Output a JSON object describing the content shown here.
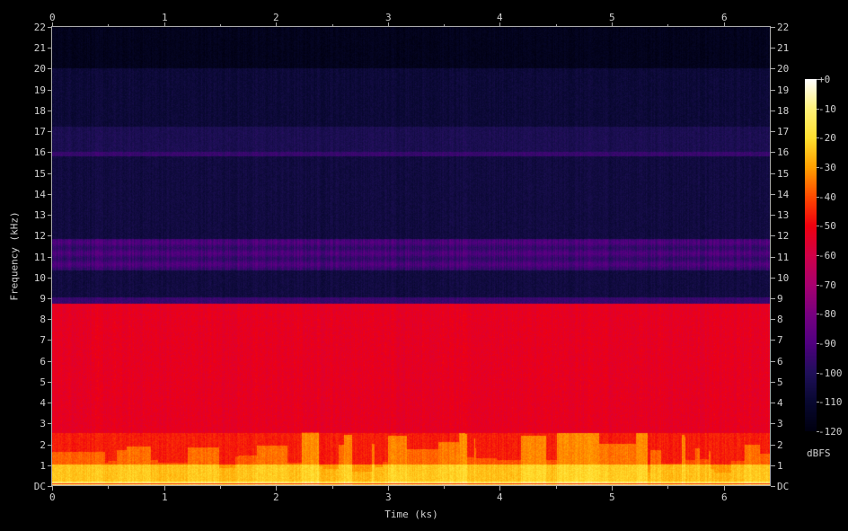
{
  "chart_data": {
    "type": "heatmap",
    "title": "",
    "xlabel": "Time (ks)",
    "ylabel": "Frequency (kHz)",
    "xlim": [
      0,
      6.42
    ],
    "ylim": [
      0,
      22
    ],
    "x_ticks": [
      "0",
      "1",
      "2",
      "3",
      "4",
      "5",
      "6"
    ],
    "y_ticks": [
      "DC",
      "1",
      "2",
      "3",
      "4",
      "5",
      "6",
      "7",
      "8",
      "9",
      "10",
      "11",
      "12",
      "13",
      "14",
      "15",
      "16",
      "17",
      "18",
      "19",
      "20",
      "21",
      "22"
    ],
    "colorbar": {
      "unit": "dBFS",
      "range": [
        -120,
        0
      ],
      "ticks": [
        "+0",
        "-10",
        "-20",
        "-30",
        "-40",
        "-50",
        "-60",
        "-70",
        "-80",
        "-90",
        "-100",
        "-110",
        "-120"
      ],
      "colors": [
        "#ffffff",
        "#fff27a",
        "#ffe030",
        "#ffa000",
        "#ff4a00",
        "#f00010",
        "#d00048",
        "#a80070",
        "#780080",
        "#500080",
        "#20105a",
        "#080830",
        "#000010"
      ]
    },
    "level_profile_dbfs": [
      {
        "from_khz": 0,
        "to_khz": 0.2,
        "db": -15
      },
      {
        "from_khz": 0.2,
        "to_khz": 1,
        "db": -27
      },
      {
        "from_khz": 1,
        "to_khz": 2.5,
        "db": -42
      },
      {
        "from_khz": 2.5,
        "to_khz": 8.7,
        "db": -53
      },
      {
        "from_khz": 8.7,
        "to_khz": 9,
        "db": -95
      },
      {
        "from_khz": 9,
        "to_khz": 10.3,
        "db": -106
      },
      {
        "from_khz": 10.3,
        "to_khz": 11.8,
        "db": -93
      },
      {
        "from_khz": 11.8,
        "to_khz": 15.8,
        "db": -106
      },
      {
        "from_khz": 15.8,
        "to_khz": 16,
        "db": -95
      },
      {
        "from_khz": 16,
        "to_khz": 17.2,
        "db": -102
      },
      {
        "from_khz": 17.2,
        "to_khz": 20,
        "db": -108
      },
      {
        "from_khz": 20,
        "to_khz": 22,
        "db": -116
      }
    ]
  }
}
